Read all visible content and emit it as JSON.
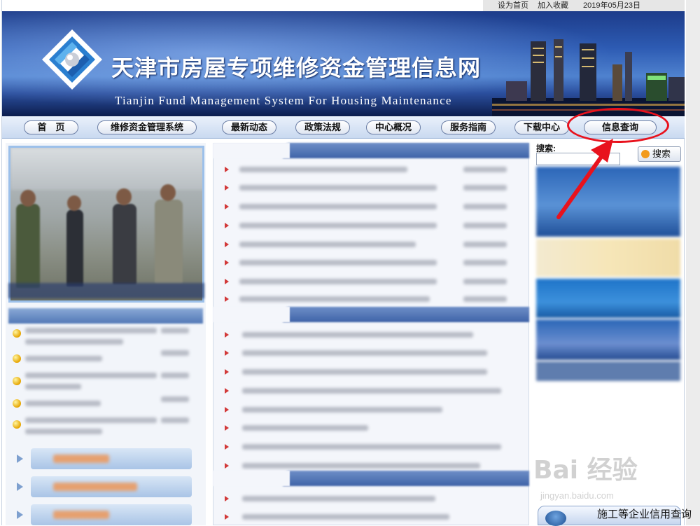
{
  "top_links": {
    "set_home": "设为首页",
    "add_favorite": "加入收藏",
    "date": "2019年05月23日"
  },
  "header": {
    "title": "天津市房屋专项维修资金管理信息网",
    "subtitle": "Tianjin Fund Management System For Housing Maintenance"
  },
  "nav": [
    {
      "label": "首　页"
    },
    {
      "label": "维修资金管理系统"
    },
    {
      "label": "最新动态"
    },
    {
      "label": "政策法规"
    },
    {
      "label": "中心概况"
    },
    {
      "label": "服务指南"
    },
    {
      "label": "下载中心"
    },
    {
      "label": "信息查询"
    }
  ],
  "search": {
    "label": "搜索:",
    "button": "搜索",
    "value": ""
  },
  "badge": {
    "text": "施工等企业信用查询"
  },
  "watermark": {
    "text": "Bai 经验",
    "url": "jingyan.baidu.com"
  },
  "colors": {
    "annotation": "#e8121d",
    "nav_active": "#e8121d",
    "banner": "#2d5bb3"
  }
}
